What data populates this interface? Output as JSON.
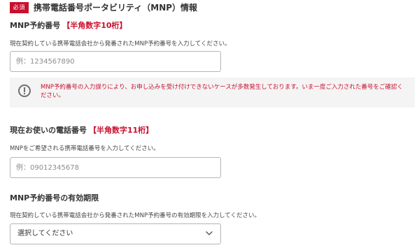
{
  "section": {
    "required_badge": "必須",
    "title": "携帯電話番号ポータビリティ（MNP）情報"
  },
  "mnp_number": {
    "label": "MNP予約番号",
    "required_note": "【半角数字10桁】",
    "help": "現在契約している携帯電話会社から発番されたMNP予約番号を入力してください。",
    "placeholder": "例：1234567890",
    "value": ""
  },
  "warning": {
    "icon": "exclamation-circle-icon",
    "text": "MNP予約番号の入力誤りにより、お申し込みを受け付けできないケースが多数発生しております。いま一度ご入力された番号をご確認ください。"
  },
  "phone_number": {
    "label": "現在お使いの電話番号",
    "required_note": "【半角数字11桁】",
    "help": "MNPをご希望される携帯電話番号を入力してください。",
    "placeholder": "例：09012345678",
    "value": ""
  },
  "expiry": {
    "label": "MNP予約番号の有効期限",
    "help": "現在契約している携帯電話会社から発番されたMNP予約番号の有効期限を入力してください。",
    "selected": "選択してください",
    "icon": "chevron-down-icon"
  },
  "colors": {
    "accent_red": "#c8102e",
    "text": "#333333",
    "border": "#b5b5b5",
    "warning_bg": "#f4f4f4"
  }
}
